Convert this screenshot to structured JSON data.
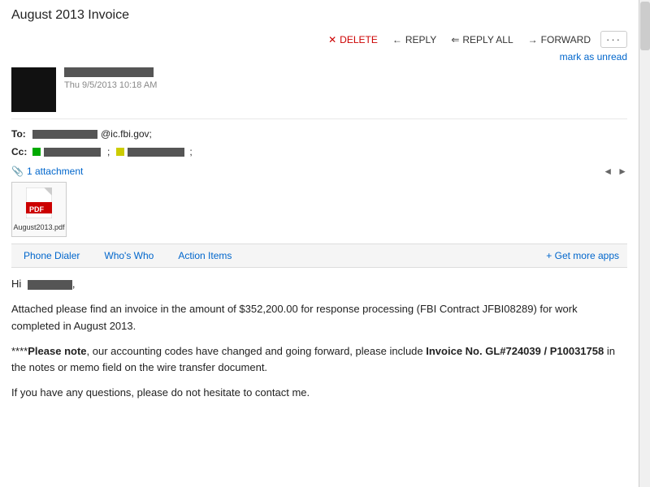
{
  "email": {
    "title": "August 2013 Invoice",
    "sender": {
      "name_redacted": true,
      "date": "Thu 9/5/2013 10:18 AM"
    },
    "to_label": "To:",
    "to_address_suffix": "@ic.fbi.gov;",
    "cc_label": "Cc:",
    "attachment_count": "1 attachment",
    "attachment_filename": "August2013.pdf",
    "body": {
      "greeting": "Hi",
      "paragraph1": "Attached please find an invoice in the amount of $352,200.00 for response processing (FBI Contract JFBI08289) for work completed in August 2013.",
      "paragraph2_prefix": "****",
      "paragraph2_bold_start": "Please note",
      "paragraph2_middle": ", our accounting codes have changed and going forward, please include ",
      "paragraph2_bold_end": "Invoice No. GL#724039 / P10031758",
      "paragraph2_suffix": " in the notes or memo field on the wire transfer document.",
      "paragraph3": "If you have any questions, please do not hesitate to contact me."
    }
  },
  "toolbar": {
    "delete_label": "DELETE",
    "reply_label": "REPLY",
    "reply_all_label": "REPLY ALL",
    "forward_label": "FORWARD",
    "more_label": "···"
  },
  "mark_unread": {
    "label": "mark as unread"
  },
  "tabs": [
    {
      "id": "phone-dialer",
      "label": "Phone Dialer",
      "active": false
    },
    {
      "id": "whos-who",
      "label": "Who's Who",
      "active": false
    },
    {
      "id": "action-items",
      "label": "Action Items",
      "active": false
    }
  ],
  "get_more_apps": {
    "label": "+ Get more apps"
  },
  "cc_recipients": [
    {
      "color": "#00aa00"
    },
    {
      "color": "#cccc00"
    }
  ]
}
